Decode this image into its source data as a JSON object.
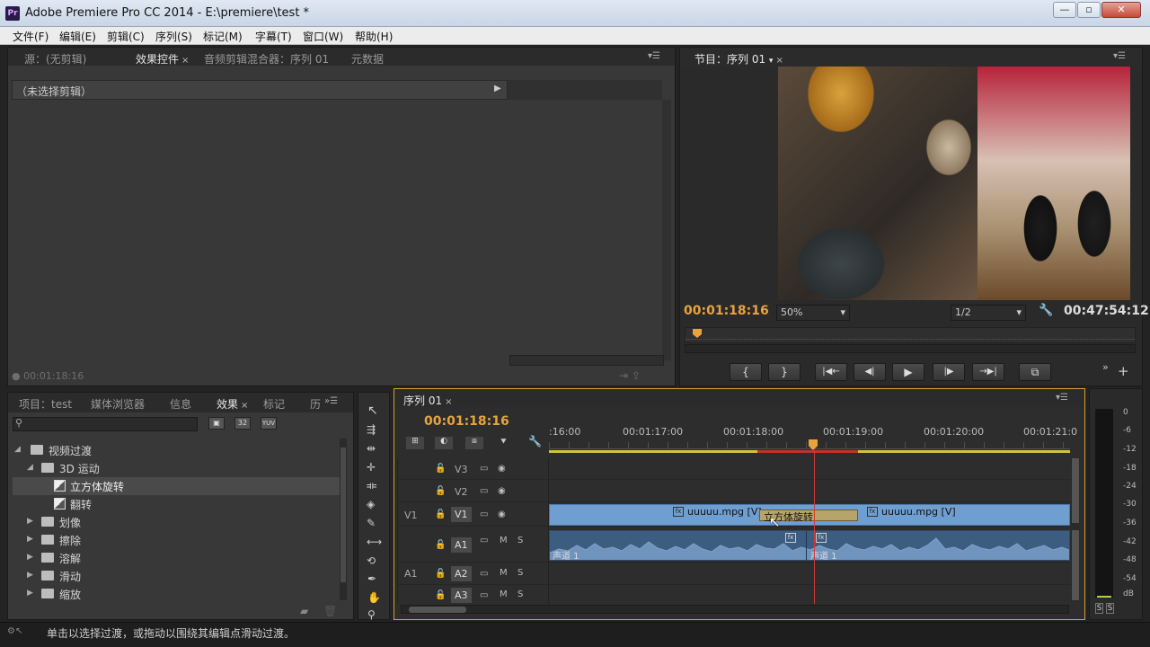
{
  "window": {
    "title": "Adobe Premiere Pro CC 2014 - E:\\premiere\\test *",
    "app_icon": "Pr"
  },
  "menu": [
    "文件(F)",
    "编辑(E)",
    "剪辑(C)",
    "序列(S)",
    "标记(M)",
    "字幕(T)",
    "窗口(W)",
    "帮助(H)"
  ],
  "source_panel": {
    "tabs": [
      "源：(无剪辑)",
      "效果控件",
      "音频剪辑混合器：序列 01",
      "元数据"
    ],
    "no_clip_text": "（未选择剪辑）",
    "timecode": "00:01:18:16"
  },
  "program": {
    "tab": "节目：序列 01",
    "timecode": "00:01:18:16",
    "zoom": "50%",
    "resolution": "1/2",
    "duration": "00:47:54:12"
  },
  "transport": [
    "{",
    "}",
    "|◀←",
    "◀|",
    "▶",
    "|▶",
    "→▶|",
    "⧉"
  ],
  "project_panel": {
    "tabs": [
      "项目：test",
      "媒体浏览器",
      "信息",
      "效果",
      "标记",
      "历"
    ],
    "search_placeholder": "",
    "preset_icons": [
      "32",
      "YUV"
    ],
    "tree": [
      {
        "label": "视频过渡",
        "level": 0,
        "expanded": true
      },
      {
        "label": "3D 运动",
        "level": 1,
        "expanded": true
      },
      {
        "label": "立方体旋转",
        "level": 2,
        "selected": true
      },
      {
        "label": "翻转",
        "level": 2
      },
      {
        "label": "划像",
        "level": 1
      },
      {
        "label": "擦除",
        "level": 1
      },
      {
        "label": "溶解",
        "level": 1
      },
      {
        "label": "滑动",
        "level": 1
      },
      {
        "label": "缩放",
        "level": 1
      }
    ]
  },
  "timeline": {
    "tab": "序列 01",
    "timecode": "00:01:18:16",
    "ruler": [
      ":16:00",
      "00:01:17:00",
      "00:01:18:00",
      "00:01:19:00",
      "00:01:20:00",
      "00:01:21:0"
    ],
    "tracks": [
      {
        "name": "V3",
        "source": ""
      },
      {
        "name": "V2",
        "source": ""
      },
      {
        "name": "V1",
        "source": "V1"
      },
      {
        "name": "A1",
        "source": "",
        "m": "M",
        "s": "S"
      },
      {
        "name": "A2",
        "source": "A1",
        "m": "M",
        "s": "S"
      },
      {
        "name": "A3",
        "source": "",
        "m": "M",
        "s": "S"
      }
    ],
    "clips": {
      "v1_left": "uuuuu.mpg [V]",
      "v1_right": "uuuuu.mpg [V]",
      "transition": "立方体旋转",
      "audio_left": "声道 1",
      "audio_right": "声道 1",
      "fx_badge": "fx"
    }
  },
  "meter": {
    "labels": [
      "0",
      "-6",
      "-12",
      "-18",
      "-24",
      "-30",
      "-36",
      "-42",
      "-48",
      "-54",
      "dB"
    ],
    "solo": [
      "S",
      "S"
    ]
  },
  "status": "单击以选择过渡，或拖动以围绕其编辑点滑动过渡。"
}
